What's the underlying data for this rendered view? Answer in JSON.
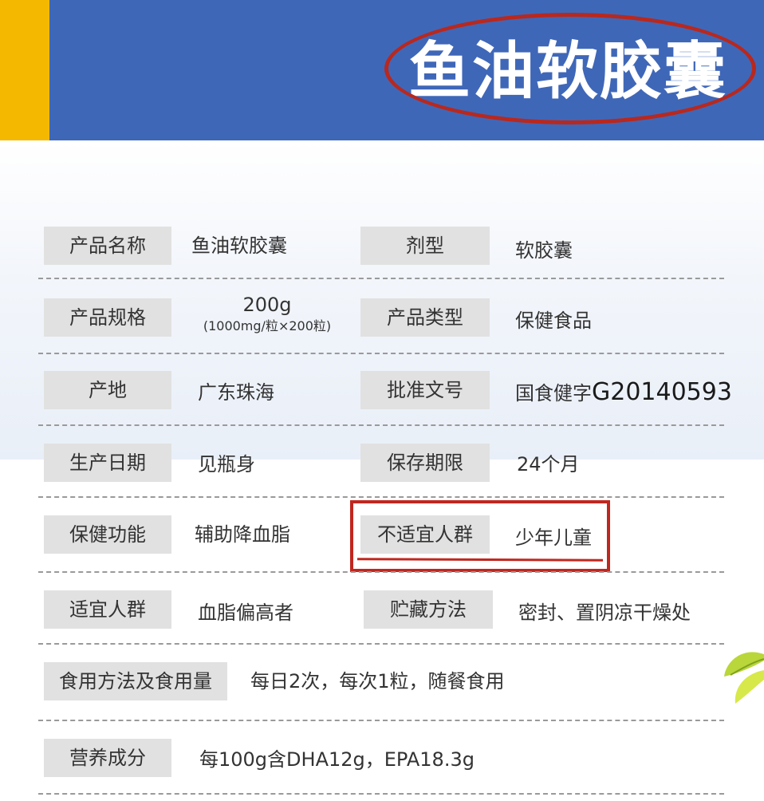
{
  "banner": {
    "title": "鱼油软胶囊",
    "accent_color": "#f5b800",
    "bg_color": "#3f67b8",
    "highlight_color": "#c0271f"
  },
  "rows": {
    "r1": {
      "l1": "产品名称",
      "v1": "鱼油软胶囊",
      "l2": "剂型",
      "v2": "软胶囊"
    },
    "r2": {
      "l1": "产品规格",
      "v1_main": "200g",
      "v1_sub": "(1000mg/粒×200粒)",
      "l2": "产品类型",
      "v2": "保健食品"
    },
    "r3": {
      "l1": "产地",
      "v1": "广东珠海",
      "l2": "批准文号",
      "v2_prefix": "国食健字",
      "v2_code": "G20140593"
    },
    "r4": {
      "l1": "生产日期",
      "v1": "见瓶身",
      "l2": "保存期限",
      "v2": "24个月"
    },
    "r5": {
      "l1": "保健功能",
      "v1": "辅助降血脂",
      "l2": "不适宜人群",
      "v2": "少年儿童"
    },
    "r6": {
      "l1": "适宜人群",
      "v1": "血脂偏高者",
      "l2": "贮藏方法",
      "v2": "密封、置阴凉干燥处"
    },
    "r7": {
      "l1": "食用方法及食用量",
      "v1": "每日2次，每次1粒，随餐食用"
    },
    "r8": {
      "l1": "营养成分",
      "v1": "每100g含DHA12g，EPA18.3g"
    }
  }
}
